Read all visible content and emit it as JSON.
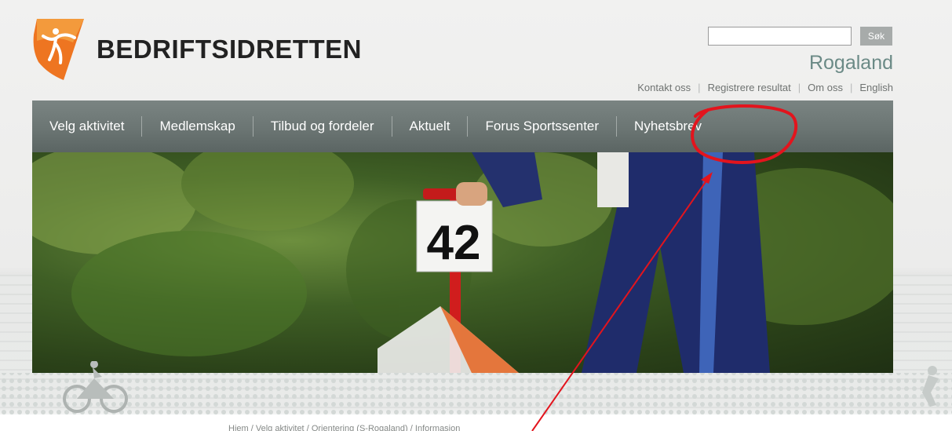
{
  "header": {
    "logo_text": "BEDRIFTSIDRETTEN",
    "search": {
      "value": "",
      "placeholder": "",
      "button_label": "Søk"
    },
    "region": "Rogaland",
    "top_links": [
      "Kontakt oss",
      "Registrere resultat",
      "Om oss",
      "English"
    ]
  },
  "nav": {
    "items": [
      "Velg aktivitet",
      "Medlemskap",
      "Tilbud og fordeler",
      "Aktuelt",
      "Forus Sportssenter",
      "Nyhetsbrev"
    ]
  },
  "hero": {
    "marker_number": "42"
  },
  "breadcrumb": [
    "Hjem",
    "Velg aktivitet",
    "Orientering (S-Rogaland)",
    "Informasjon"
  ],
  "colors": {
    "logo_orange": "#ee7521",
    "nav_bg": "#6b7573",
    "region_text": "#6b8a86",
    "annotation_red": "#e3141d"
  },
  "icons": [
    "logo-figure-icon",
    "cyclist-silhouette-icon",
    "runner-silhouette-icon"
  ]
}
